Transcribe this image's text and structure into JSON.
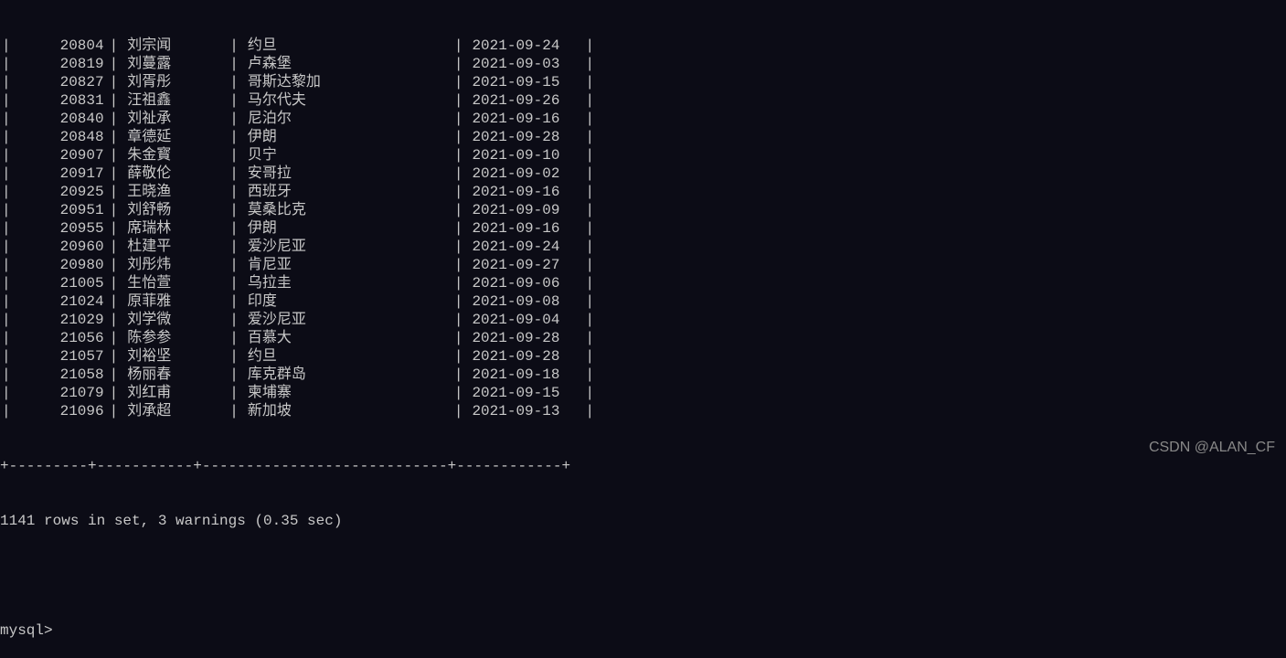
{
  "rows": [
    {
      "id": "20804",
      "name": "刘宗闻",
      "country": "约旦",
      "date": "2021-09-24"
    },
    {
      "id": "20819",
      "name": "刘蔓露",
      "country": "卢森堡",
      "date": "2021-09-03"
    },
    {
      "id": "20827",
      "name": "刘胥彤",
      "country": "哥斯达黎加",
      "date": "2021-09-15"
    },
    {
      "id": "20831",
      "name": "汪祖鑫",
      "country": "马尔代夫",
      "date": "2021-09-26"
    },
    {
      "id": "20840",
      "name": "刘祉承",
      "country": "尼泊尔",
      "date": "2021-09-16"
    },
    {
      "id": "20848",
      "name": "章德延",
      "country": "伊朗",
      "date": "2021-09-28"
    },
    {
      "id": "20907",
      "name": "朱金寳",
      "country": "贝宁",
      "date": "2021-09-10"
    },
    {
      "id": "20917",
      "name": "薛敬伦",
      "country": "安哥拉",
      "date": "2021-09-02"
    },
    {
      "id": "20925",
      "name": "王晓渔",
      "country": "西班牙",
      "date": "2021-09-16"
    },
    {
      "id": "20951",
      "name": "刘舒畅",
      "country": "莫桑比克",
      "date": "2021-09-09"
    },
    {
      "id": "20955",
      "name": "席瑞林",
      "country": "伊朗",
      "date": "2021-09-16"
    },
    {
      "id": "20960",
      "name": "杜建平",
      "country": "爱沙尼亚",
      "date": "2021-09-24"
    },
    {
      "id": "20980",
      "name": "刘彤炜",
      "country": "肯尼亚",
      "date": "2021-09-27"
    },
    {
      "id": "21005",
      "name": "生怡萱",
      "country": "乌拉圭",
      "date": "2021-09-06"
    },
    {
      "id": "21024",
      "name": "原菲雅",
      "country": "印度",
      "date": "2021-09-08"
    },
    {
      "id": "21029",
      "name": "刘学微",
      "country": "爱沙尼亚",
      "date": "2021-09-04"
    },
    {
      "id": "21056",
      "name": "陈参参",
      "country": "百慕大",
      "date": "2021-09-28"
    },
    {
      "id": "21057",
      "name": "刘裕坚",
      "country": "约旦",
      "date": "2021-09-28"
    },
    {
      "id": "21058",
      "name": "杨丽春",
      "country": "库克群岛",
      "date": "2021-09-18"
    },
    {
      "id": "21079",
      "name": "刘红甫",
      "country": "柬埔寨",
      "date": "2021-09-15"
    },
    {
      "id": "21096",
      "name": "刘承超",
      "country": "新加坡",
      "date": "2021-09-13"
    }
  ],
  "separator": "+---------+-----------+----------------------------+------------+",
  "status": "1141 rows in set, 3 warnings (0.35 sec)",
  "prompt": "mysql>",
  "watermark": "CSDN @ALAN_CF"
}
